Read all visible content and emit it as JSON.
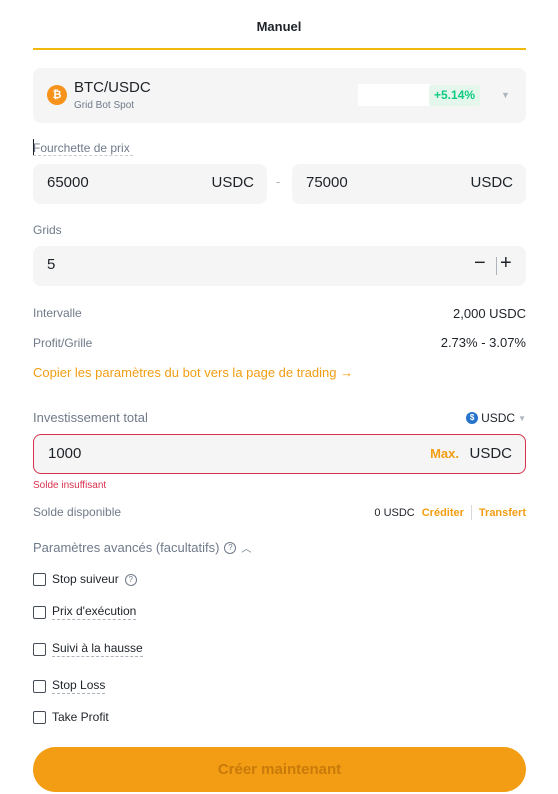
{
  "tab": {
    "title": "Manuel"
  },
  "pair": {
    "icon_glyph": "₿",
    "name": "BTC/USDC",
    "subtitle": "Grid Bot Spot",
    "change": "+5.14%",
    "icon": "chevron-down-icon"
  },
  "price_range": {
    "label": "Fourchette de prix",
    "min_value": "65000",
    "max_value": "75000",
    "unit": "USDC",
    "separator": "-"
  },
  "grids": {
    "label": "Grids",
    "value": "5",
    "minus": "−",
    "plus": "+"
  },
  "stats": {
    "interval_label": "Intervalle",
    "interval_value": "2,000 USDC",
    "profit_label": "Profit/Grille",
    "profit_value": "2.73% - 3.07%"
  },
  "copy_link": "Copier les paramètres du bot vers la page de trading →",
  "investment": {
    "label": "Investissement total",
    "currency": "USDC",
    "currency_icon_glyph": "$",
    "value": "1000",
    "max_label": "Max.",
    "unit": "USDC",
    "error": "Solde insuffisant"
  },
  "balance": {
    "label": "Solde disponible",
    "value": "0 USDC",
    "credit_link": "Créditer",
    "transfer_link": "Transfert"
  },
  "advanced": {
    "title": "Paramètres avancés (facultatifs)",
    "options": [
      {
        "label": "Stop suiveur",
        "checked": false
      },
      {
        "label": "Prix d'exécution",
        "checked": false
      },
      {
        "label": "Suivi à la hausse",
        "checked": false
      },
      {
        "label": "Stop Loss",
        "checked": false
      },
      {
        "label": "Take Profit",
        "checked": false
      }
    ]
  },
  "create_button": "Créer maintenant",
  "colors": {
    "accent": "#f0b90b",
    "button": "#f29d13",
    "positive": "#0ecb81",
    "error": "#d9304e"
  }
}
